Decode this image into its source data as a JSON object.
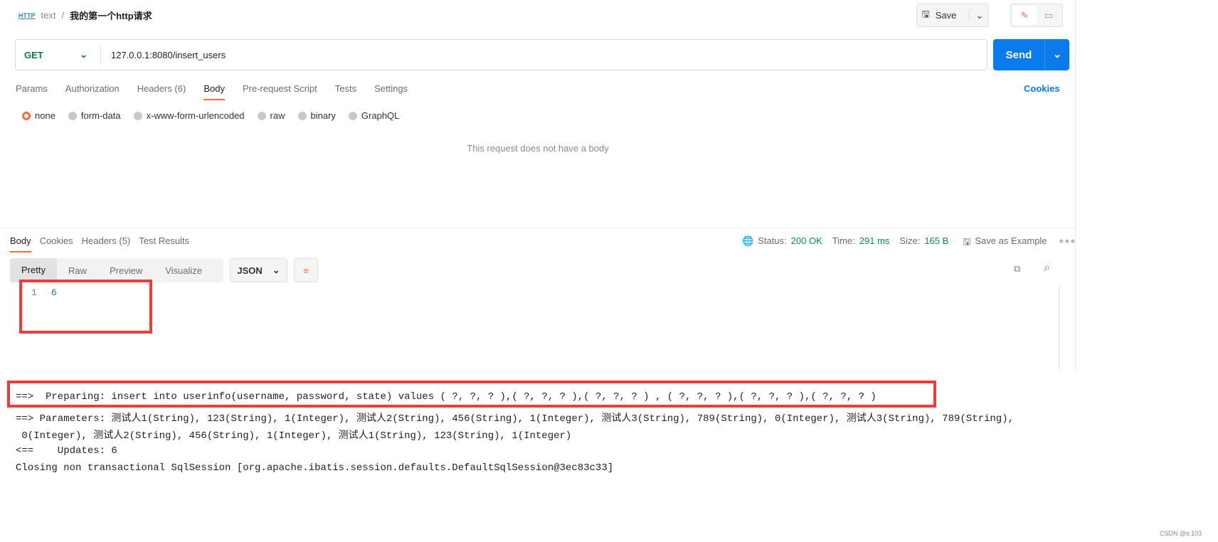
{
  "header": {
    "collection": "text",
    "separator": "/",
    "request_name": "我的第一个http请求",
    "save_label": "Save"
  },
  "request": {
    "method": "GET",
    "url": "127.0.0.1:8080/insert_users",
    "send_label": "Send"
  },
  "request_tabs": [
    {
      "label": "Params"
    },
    {
      "label": "Authorization"
    },
    {
      "label": "Headers (6)"
    },
    {
      "label": "Body",
      "active": true
    },
    {
      "label": "Pre-request Script"
    },
    {
      "label": "Tests"
    },
    {
      "label": "Settings"
    }
  ],
  "cookies_link": "Cookies",
  "body_types": [
    {
      "label": "none",
      "selected": true
    },
    {
      "label": "form-data"
    },
    {
      "label": "x-www-form-urlencoded"
    },
    {
      "label": "raw"
    },
    {
      "label": "binary"
    },
    {
      "label": "GraphQL"
    }
  ],
  "no_body_message": "This request does not have a body",
  "response_tabs": [
    {
      "label": "Body",
      "active": true
    },
    {
      "label": "Cookies"
    },
    {
      "label": "Headers (5)"
    },
    {
      "label": "Test Results"
    }
  ],
  "response_meta": {
    "status_label": "Status:",
    "status": "200 OK",
    "time_label": "Time:",
    "time": "291 ms",
    "size_label": "Size:",
    "size": "165 B",
    "save_example": "Save as Example"
  },
  "view_modes": [
    "Pretty",
    "Raw",
    "Preview",
    "Visualize"
  ],
  "format": "JSON",
  "response_lines": [
    {
      "num": "1",
      "text": "6"
    }
  ],
  "console": [
    "==>  Preparing: insert into userinfo(username, password, state) values ( ?, ?, ? ),( ?, ?, ? ),( ?, ?, ? ) , ( ?, ?, ? ),( ?, ?, ? ),( ?, ?, ? )",
    "==> Parameters: 测试人1(String), 123(String), 1(Integer), 测试人2(String), 456(String), 1(Integer), 测试人3(String), 789(String), 0(Integer), 测试人3(String), 789(String),",
    " 0(Integer), 测试人2(String), 456(String), 1(Integer), 测试人1(String), 123(String), 1(Integer)",
    "<==    Updates: 6",
    "Closing non transactional SqlSession [org.apache.ibatis.session.defaults.DefaultSqlSession@3ec83c33]"
  ],
  "watermark": "CSDN @s:103",
  "colors": {
    "accent": "#ff6c37",
    "send": "#097bed",
    "success": "#0f8a4f",
    "highlight": "#ef3a3a"
  }
}
